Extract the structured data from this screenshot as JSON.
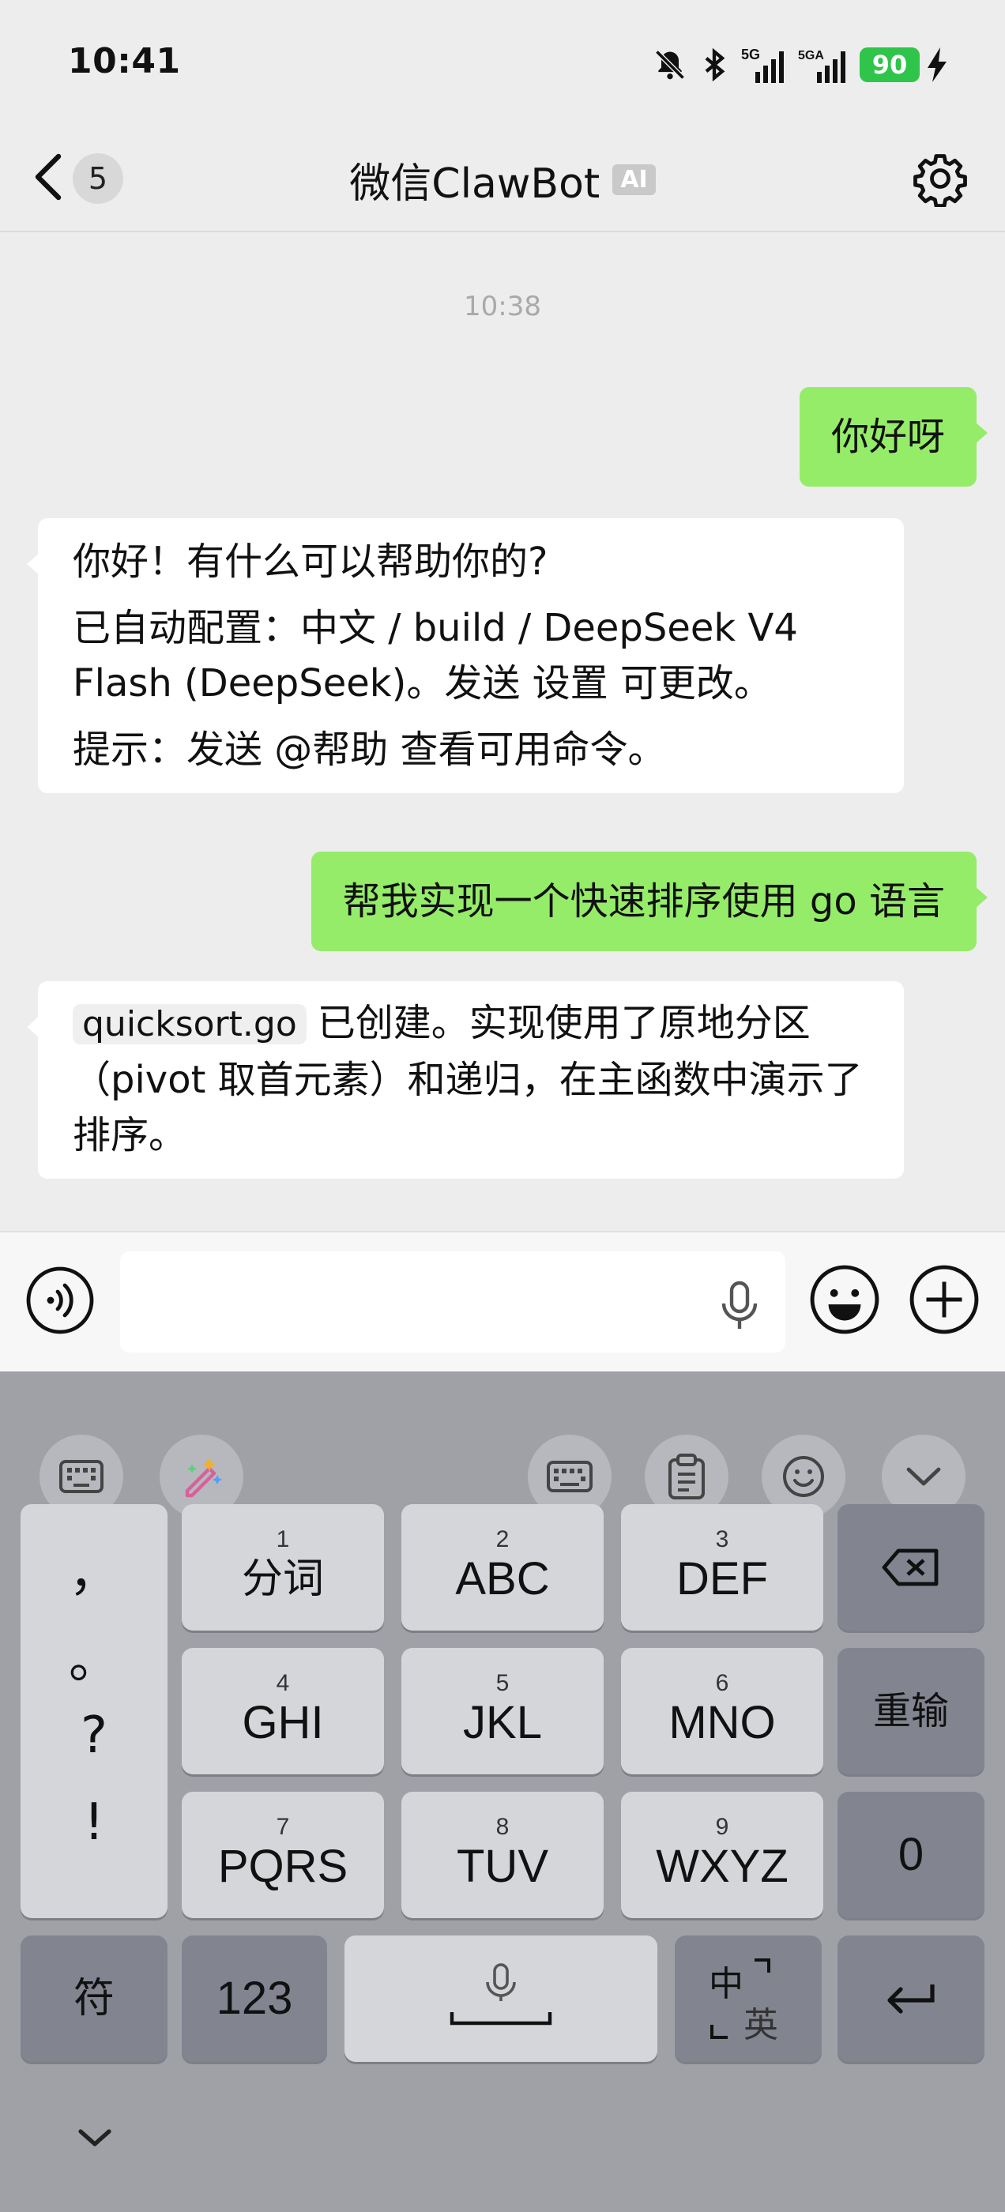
{
  "status": {
    "time": "10:41",
    "network1": "5G",
    "network2": "5GA",
    "battery": "90"
  },
  "nav": {
    "back_count": "5",
    "title": "微信ClawBot",
    "ai_badge": "AI"
  },
  "chat": {
    "timestamp": "10:38",
    "messages": [
      {
        "from": "me",
        "text": "你好呀"
      },
      {
        "from": "bot",
        "lines": [
          "你好！有什么可以帮助你的?",
          "已自动配置：中文 / build / DeepSeek V4 Flash (DeepSeek)。发送 设置 可更改。",
          "提示：发送 @帮助 查看可用命令。"
        ]
      },
      {
        "from": "me",
        "text": "帮我实现一个快速排序使用 go 语言"
      },
      {
        "from": "bot",
        "code": "quicksort.go",
        "text": "已创建。实现使用了原地分区（pivot 取首元素）和递归，在主函数中演示了排序。"
      }
    ]
  },
  "input": {
    "value": "",
    "placeholder": ""
  },
  "keyboard": {
    "punct": [
      "，",
      "。",
      "?",
      "!"
    ],
    "rows": [
      [
        {
          "num": "1",
          "label": "分词"
        },
        {
          "num": "2",
          "label": "ABC"
        },
        {
          "num": "3",
          "label": "DEF"
        }
      ],
      [
        {
          "num": "4",
          "label": "GHI"
        },
        {
          "num": "5",
          "label": "JKL"
        },
        {
          "num": "6",
          "label": "MNO"
        }
      ],
      [
        {
          "num": "7",
          "label": "PQRS"
        },
        {
          "num": "8",
          "label": "TUV"
        },
        {
          "num": "9",
          "label": "WXYZ"
        }
      ]
    ],
    "reenter": "重输",
    "zero": "0",
    "symbols": "符",
    "numbers": "123",
    "lang_zh": "中",
    "lang_en": "英"
  }
}
